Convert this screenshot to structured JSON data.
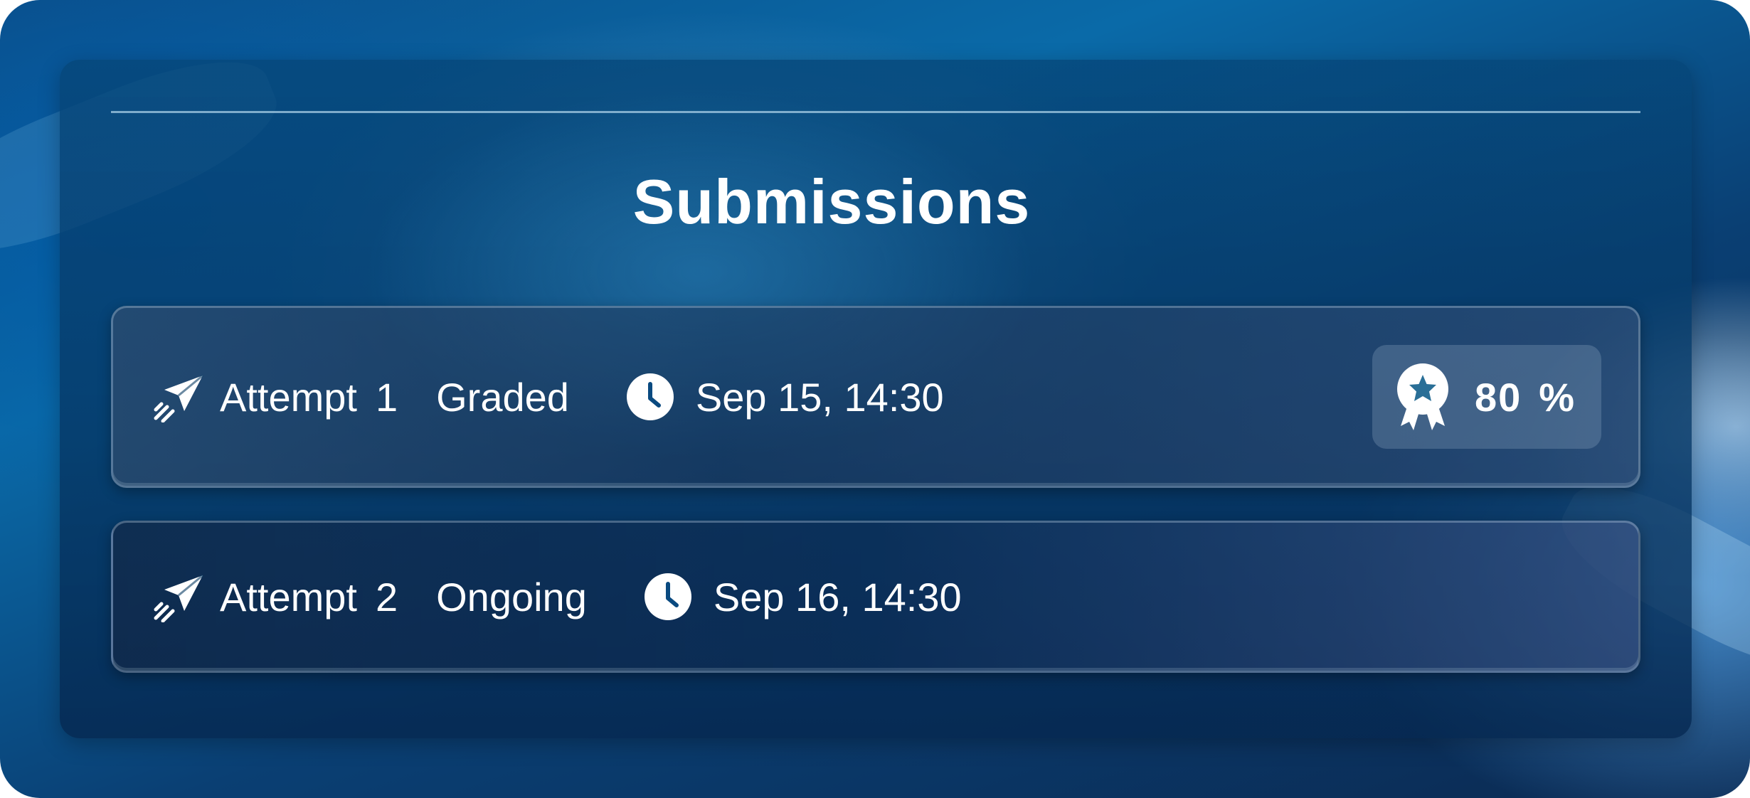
{
  "title": "Submissions",
  "submissions": [
    {
      "attempt_word": "Attempt",
      "attempt_number": "1",
      "status": "Graded",
      "timestamp": "Sep 15, 14:30",
      "score": "80",
      "score_unit": "%"
    },
    {
      "attempt_word": "Attempt",
      "attempt_number": "2",
      "status": "Ongoing",
      "timestamp": "Sep 16, 14:30"
    }
  ],
  "icons": {
    "attempt": "paper-plane-send-icon",
    "time": "clock-icon",
    "score": "award-ribbon-icon"
  },
  "colors": {
    "text": "#ffffff",
    "background_primary": "#0a6aa8",
    "panel": "#064678"
  }
}
